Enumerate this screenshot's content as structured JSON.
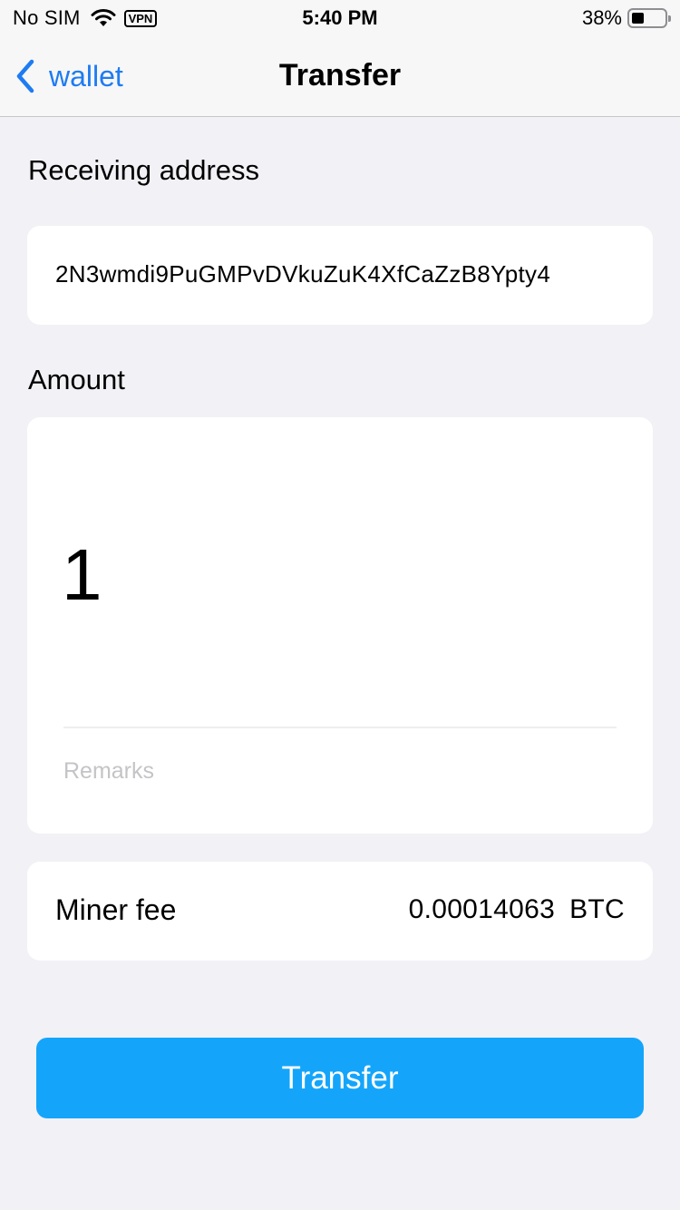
{
  "status_bar": {
    "carrier": "No SIM",
    "vpn": "VPN",
    "time": "5:40 PM",
    "battery_percent": "38%",
    "battery_level": 0.38
  },
  "nav": {
    "back_label": "wallet",
    "title": "Transfer"
  },
  "receiving_address": {
    "label": "Receiving address",
    "value": "2N3wmdi9PuGMPvDVkuZuK4XfCaZzB8Ypty4"
  },
  "amount": {
    "label": "Amount",
    "value": "1",
    "remarks_placeholder": "Remarks"
  },
  "miner_fee": {
    "label": "Miner fee",
    "value": "0.00014063",
    "unit": "BTC"
  },
  "transfer_button": {
    "label": "Transfer"
  },
  "colors": {
    "accent": "#1e7cf2",
    "button": "#14a5fb",
    "background": "#f1f1f6"
  }
}
